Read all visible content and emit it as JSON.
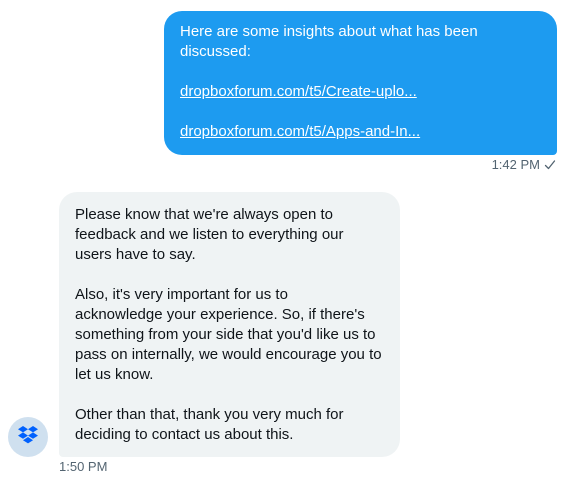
{
  "outgoing": {
    "lines": [
      "Here are some insights about what has been",
      "discussed:"
    ],
    "links": [
      "dropboxforum.com/t5/Create-uplo...",
      "dropboxforum.com/t5/Apps-and-In..."
    ],
    "time": "1:42 PM",
    "status_icon": "check-icon"
  },
  "incoming": {
    "paragraphs": [
      [
        "Please know that we're always open to",
        "feedback and we listen to everything our",
        "users have to say."
      ],
      [
        "Also, it's very important for us to",
        "acknowledge your experience. So, if there's",
        "something from your side that you'd like us to",
        "pass on internally, we would encourage you to",
        "let us know."
      ],
      [
        "Other than that, thank you very much for",
        "deciding to contact us about this."
      ]
    ],
    "time": "1:50 PM",
    "avatar_icon": "dropbox-logo-icon"
  },
  "colors": {
    "outgoing_bubble": "#1d9bf0",
    "incoming_bubble": "#eff3f4",
    "timestamp": "#536471",
    "dropbox_blue": "#0061fe"
  }
}
